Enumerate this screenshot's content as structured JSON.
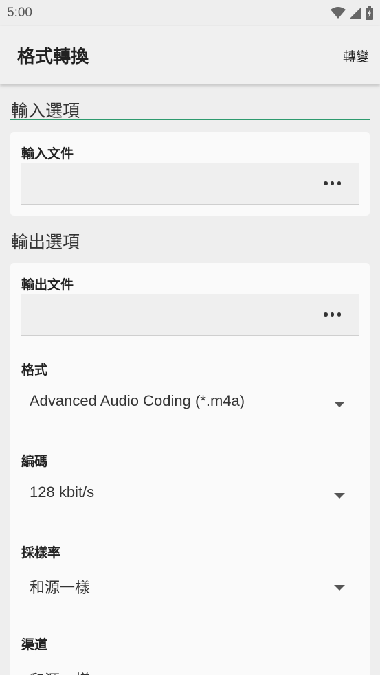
{
  "status_bar": {
    "time": "5:00",
    "icons": [
      "wifi-icon",
      "signal-icon",
      "battery-charging-icon"
    ]
  },
  "app_bar": {
    "title": "格式轉換",
    "action_label": "轉變"
  },
  "input_section": {
    "title": "輸入選項",
    "input_file": {
      "label": "輸入文件",
      "value": "",
      "browse_icon": "more-horiz-icon"
    }
  },
  "output_section": {
    "title": "輸出選項",
    "output_file": {
      "label": "輸出文件",
      "value": "",
      "browse_icon": "more-horiz-icon"
    },
    "format": {
      "label": "格式",
      "value": "Advanced Audio Coding (*.m4a)"
    },
    "encoding": {
      "label": "編碼",
      "value": "128 kbit/s"
    },
    "sample_rate": {
      "label": "採樣率",
      "value": "和源一樣"
    },
    "channels": {
      "label": "渠道",
      "value": "和源一樣"
    }
  },
  "colors": {
    "accent_line": "#2e9a6e",
    "background": "#eeeeee",
    "card": "#fafafa",
    "field": "#efefef"
  }
}
